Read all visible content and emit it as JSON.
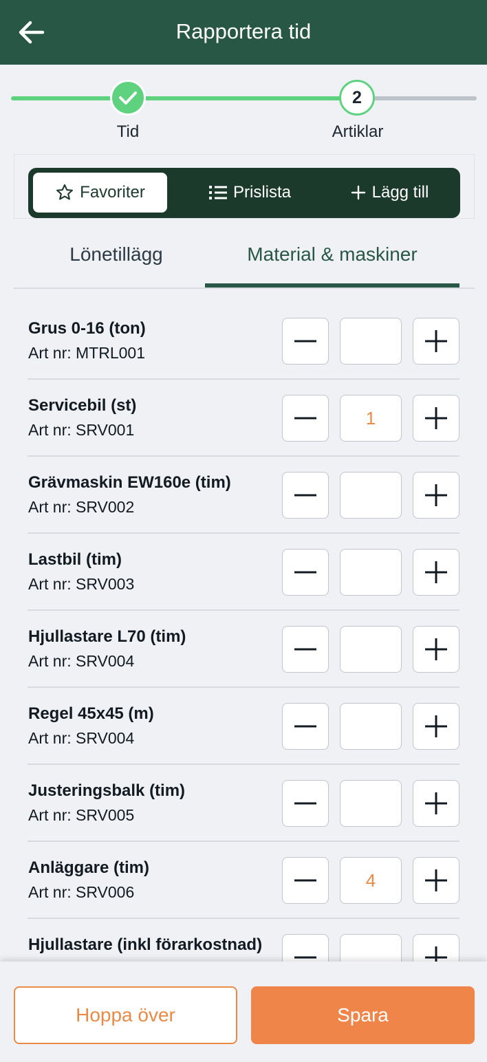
{
  "header": {
    "title": "Rapportera tid"
  },
  "stepper": {
    "steps": [
      {
        "label": "Tid",
        "status": "done"
      },
      {
        "label": "Artiklar",
        "number": "2",
        "status": "current"
      }
    ]
  },
  "segments": [
    {
      "label": "Favoriter",
      "icon": "star-icon",
      "active": true
    },
    {
      "label": "Prislista",
      "icon": "list-icon",
      "active": false
    },
    {
      "label": "Lägg till",
      "icon": "plus-icon",
      "active": false
    }
  ],
  "tabs": [
    {
      "label": "Lönetillägg",
      "active": false
    },
    {
      "label": "Material & maskiner",
      "active": true
    }
  ],
  "items": [
    {
      "name": "Grus 0-16 (ton)",
      "art": "Art nr: MTRL001",
      "qty": ""
    },
    {
      "name": "Servicebil (st)",
      "art": "Art nr: SRV001",
      "qty": "1"
    },
    {
      "name": "Grävmaskin EW160e (tim)",
      "art": "Art nr: SRV002",
      "qty": ""
    },
    {
      "name": "Lastbil (tim)",
      "art": "Art nr: SRV003",
      "qty": ""
    },
    {
      "name": "Hjullastare L70 (tim)",
      "art": "Art nr: SRV004",
      "qty": ""
    },
    {
      "name": "Regel 45x45 (m)",
      "art": "Art nr: SRV004",
      "qty": ""
    },
    {
      "name": "Justeringsbalk (tim)",
      "art": "Art nr: SRV005",
      "qty": ""
    },
    {
      "name": "Anläggare (tim)",
      "art": "Art nr: SRV006",
      "qty": "4"
    },
    {
      "name": "Hjullastare (inkl förarkostnad)",
      "art": "",
      "qty": ""
    }
  ],
  "footer": {
    "skip_label": "Hoppa över",
    "save_label": "Spara"
  },
  "colors": {
    "header_bg": "#285845",
    "accent_green": "#5fd27f",
    "accent_orange": "#f0854a",
    "segment_bg": "#1c3a2c"
  }
}
